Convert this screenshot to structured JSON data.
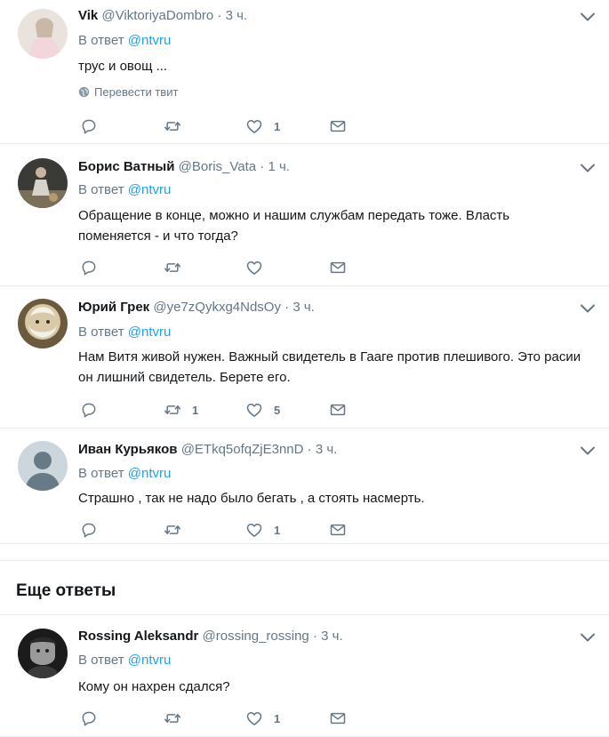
{
  "tweets": [
    {
      "fullname": "Vik",
      "username": "@ViktoriyaDombro",
      "dot": "·",
      "time": "3 ч.",
      "reply_prefix": "В ответ",
      "reply_mention": "@ntvru",
      "text": "трус и овощ ...",
      "translate_label": "Перевести твит",
      "reply_count": "",
      "retweet_count": "",
      "like_count": "1"
    },
    {
      "fullname": "Борис Ватный",
      "username": "@Boris_Vata",
      "dot": "·",
      "time": "1 ч.",
      "reply_prefix": "В ответ",
      "reply_mention": "@ntvru",
      "text": "Обращение в конце, можно и нашим службам передать тоже. Власть поменяется - и что тогда?",
      "reply_count": "",
      "retweet_count": "",
      "like_count": ""
    },
    {
      "fullname": "Юрий Грек",
      "username": "@ye7zQykxg4NdsOy",
      "dot": "·",
      "time": "3 ч.",
      "reply_prefix": "В ответ",
      "reply_mention": "@ntvru",
      "text": "Нам Витя живой нужен. Важный свидетель в Гааге против плешивого. Это расии он лишний свидетель. Берете его.",
      "reply_count": "",
      "retweet_count": "1",
      "like_count": "5"
    },
    {
      "fullname": "Иван Курьяков",
      "username": "@ETkq5ofqZjE3nnD",
      "dot": "·",
      "time": "3 ч.",
      "reply_prefix": "В ответ",
      "reply_mention": "@ntvru",
      "text": "Страшно , так не надо было бегать , а стоять насмерть.",
      "reply_count": "",
      "retweet_count": "",
      "like_count": "1"
    },
    {
      "fullname": "Rossing Aleksandr",
      "username": "@rossing_rossing",
      "dot": "·",
      "time": "3 ч.",
      "reply_prefix": "В ответ",
      "reply_mention": "@ntvru",
      "text": "Кому он нахрен сдался?",
      "reply_count": "",
      "retweet_count": "",
      "like_count": "1"
    }
  ],
  "more_replies": {
    "title": "Еще ответы"
  },
  "icons": {
    "reply": "reply-icon",
    "retweet": "retweet-icon",
    "like": "heart-icon",
    "message": "envelope-icon",
    "caret": "chevron-down-icon",
    "globe": "globe-icon"
  },
  "colors": {
    "text": "#14171a",
    "secondary": "#657786",
    "link": "#1da1f2",
    "border": "#e6ecf0"
  }
}
